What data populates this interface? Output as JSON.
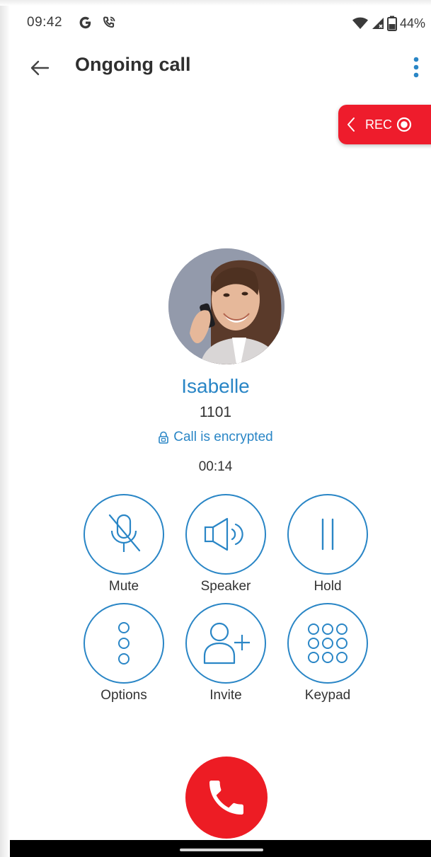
{
  "status_bar": {
    "time": "09:42",
    "battery": "44%",
    "icons": [
      "g-icon",
      "phone-call-icon",
      "wifi-icon",
      "signal-icon",
      "battery-icon"
    ]
  },
  "app_bar": {
    "title": "Ongoing call",
    "back_icon": "arrow-left-icon",
    "menu_icon": "more-vert-icon"
  },
  "recording": {
    "label": "REC",
    "color": "#ee1c2c"
  },
  "caller": {
    "name": "Isabelle",
    "number": "1101",
    "encryption": "Call is encrypted",
    "duration": "00:14"
  },
  "controls": [
    {
      "label": "Mute",
      "icon": "mic-off-icon"
    },
    {
      "label": "Speaker",
      "icon": "speaker-icon"
    },
    {
      "label": "Hold",
      "icon": "pause-icon"
    },
    {
      "label": "Options",
      "icon": "more-options-icon"
    },
    {
      "label": "Invite",
      "icon": "add-person-icon"
    },
    {
      "label": "Keypad",
      "icon": "dialpad-icon"
    }
  ],
  "end_call": {
    "icon": "phone-hangup-icon",
    "color": "#ed1c24"
  },
  "theme": {
    "accent": "#2a86c6"
  }
}
